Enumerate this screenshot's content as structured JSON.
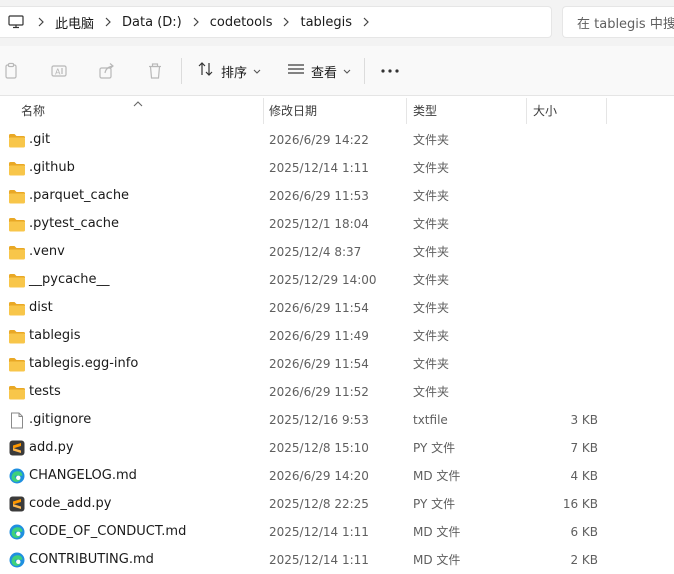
{
  "address": {
    "crumbs": [
      "此电脑",
      "Data (D:)",
      "codetools",
      "tablegis"
    ]
  },
  "search": {
    "placeholder": "在 tablegis 中搜"
  },
  "toolbar": {
    "sort_label": "排序",
    "view_label": "查看"
  },
  "columns": {
    "name": "名称",
    "date": "修改日期",
    "type": "类型",
    "size": "大小"
  },
  "files": [
    {
      "name": ".git",
      "date": "2026/6/29 14:22",
      "type": "文件夹",
      "size": "",
      "icon": "folder-icon"
    },
    {
      "name": ".github",
      "date": "2025/12/14 1:11",
      "type": "文件夹",
      "size": "",
      "icon": "folder-icon"
    },
    {
      "name": ".parquet_cache",
      "date": "2026/6/29 11:53",
      "type": "文件夹",
      "size": "",
      "icon": "folder-icon"
    },
    {
      "name": ".pytest_cache",
      "date": "2025/12/1 18:04",
      "type": "文件夹",
      "size": "",
      "icon": "folder-icon"
    },
    {
      "name": ".venv",
      "date": "2025/12/4 8:37",
      "type": "文件夹",
      "size": "",
      "icon": "folder-icon"
    },
    {
      "name": "__pycache__",
      "date": "2025/12/29 14:00",
      "type": "文件夹",
      "size": "",
      "icon": "folder-icon"
    },
    {
      "name": "dist",
      "date": "2026/6/29 11:54",
      "type": "文件夹",
      "size": "",
      "icon": "folder-icon"
    },
    {
      "name": "tablegis",
      "date": "2026/6/29 11:49",
      "type": "文件夹",
      "size": "",
      "icon": "folder-icon"
    },
    {
      "name": "tablegis.egg-info",
      "date": "2026/6/29 11:54",
      "type": "文件夹",
      "size": "",
      "icon": "folder-icon"
    },
    {
      "name": "tests",
      "date": "2026/6/29 11:52",
      "type": "文件夹",
      "size": "",
      "icon": "folder-icon"
    },
    {
      "name": ".gitignore",
      "date": "2025/12/16 9:53",
      "type": "txtfile",
      "size": "3 KB",
      "icon": "text-file-icon"
    },
    {
      "name": "add.py",
      "date": "2025/12/8 15:10",
      "type": "PY 文件",
      "size": "7 KB",
      "icon": "sublime-file-icon"
    },
    {
      "name": "CHANGELOG.md",
      "date": "2026/6/29 14:20",
      "type": "MD 文件",
      "size": "4 KB",
      "icon": "edge-file-icon"
    },
    {
      "name": "code_add.py",
      "date": "2025/12/8 22:25",
      "type": "PY 文件",
      "size": "16 KB",
      "icon": "sublime-file-icon"
    },
    {
      "name": "CODE_OF_CONDUCT.md",
      "date": "2025/12/14 1:11",
      "type": "MD 文件",
      "size": "6 KB",
      "icon": "edge-file-icon"
    },
    {
      "name": "CONTRIBUTING.md",
      "date": "2025/12/14 1:11",
      "type": "MD 文件",
      "size": "2 KB",
      "icon": "edge-file-icon"
    }
  ],
  "colors": {
    "folder": "#f8c64a",
    "folder_tab": "#e9a825",
    "accent": "#0067c0"
  }
}
